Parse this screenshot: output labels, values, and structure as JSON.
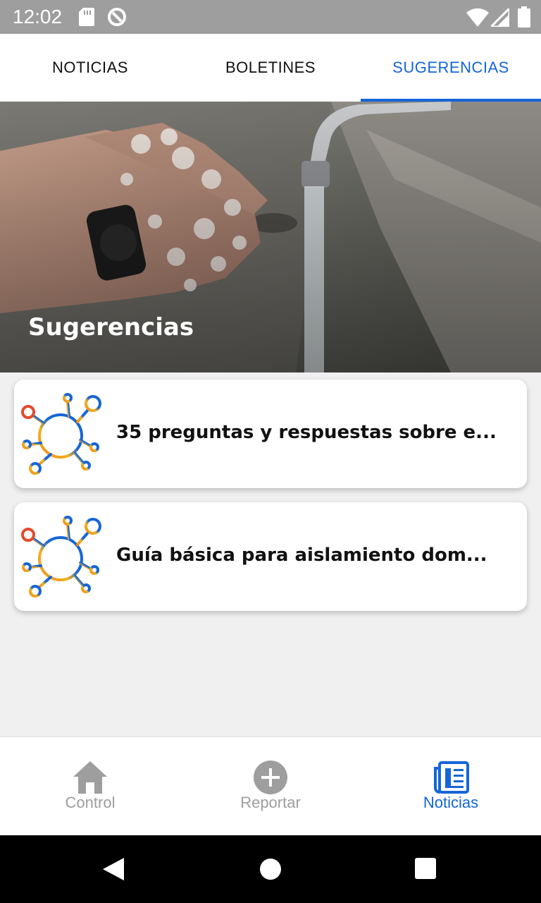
{
  "status_bar": {
    "time": "12:02",
    "icons": [
      "sd-card-icon",
      "sync-icon",
      "wifi-icon",
      "signal-icon",
      "battery-icon"
    ]
  },
  "tabs": [
    {
      "label": "NOTICIAS",
      "active": false
    },
    {
      "label": "BOLETINES",
      "active": false
    },
    {
      "label": "SUGERENCIAS",
      "active": true
    }
  ],
  "hero": {
    "title": "Sugerencias",
    "image": "hands-washing-photo"
  },
  "cards": [
    {
      "title": "35 preguntas y respuestas sobre e...",
      "icon": "virus-icon"
    },
    {
      "title": "Guía básica para aislamiento dom...",
      "icon": "virus-icon"
    }
  ],
  "bottom_nav": [
    {
      "label": "Control",
      "icon": "home-icon",
      "active": false
    },
    {
      "label": "Reportar",
      "icon": "add-circle-icon",
      "active": false
    },
    {
      "label": "Noticias",
      "icon": "newspaper-icon",
      "active": true
    }
  ],
  "colors": {
    "accent": "#1565d8",
    "inactive": "#9e9e9e",
    "status_bar": "#9e9e9e"
  }
}
